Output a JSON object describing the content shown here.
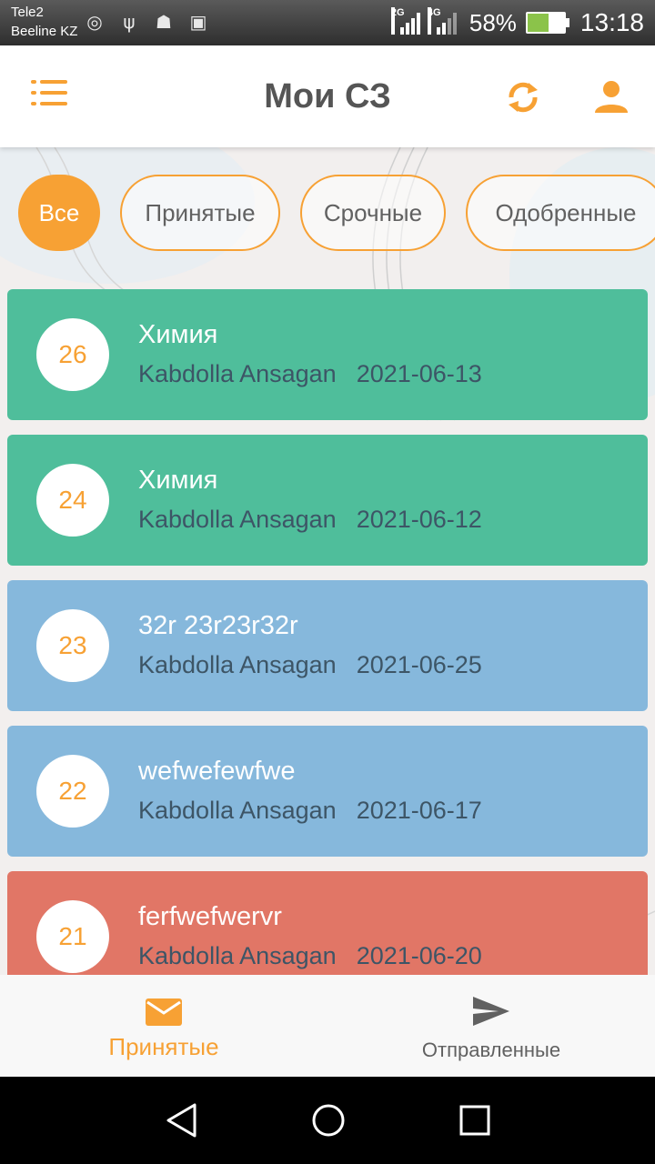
{
  "status_bar": {
    "carrier_1": "Tele2",
    "carrier_2": "Beeline KZ",
    "network_1": "2G",
    "network_2": "4G",
    "battery": "58%",
    "battery_level": 0.58,
    "time": "13:18"
  },
  "app_bar": {
    "title": "Мои СЗ"
  },
  "filters": [
    {
      "label": "Все",
      "active": true
    },
    {
      "label": "Принятые",
      "active": false
    },
    {
      "label": "Срочные",
      "active": false
    },
    {
      "label": "Одобренные",
      "active": false
    }
  ],
  "items": [
    {
      "number": "26",
      "title": "Химия",
      "author": "Kabdolla Ansagan",
      "date": "2021-06-13",
      "color": "#4fbe9b"
    },
    {
      "number": "24",
      "title": "Химия",
      "author": "Kabdolla Ansagan",
      "date": "2021-06-12",
      "color": "#4fbe9b"
    },
    {
      "number": "23",
      "title": "32r 23r23r32r",
      "author": "Kabdolla Ansagan",
      "date": "2021-06-25",
      "color": "#86b8dc"
    },
    {
      "number": "22",
      "title": "wefwefewfwe",
      "author": "Kabdolla Ansagan",
      "date": "2021-06-17",
      "color": "#86b8dc"
    },
    {
      "number": "21",
      "title": "ferfwefwervr",
      "author": "Kabdolla Ansagan",
      "date": "2021-06-20",
      "color": "#e17666"
    }
  ],
  "bottom_nav": {
    "received": "Принятые",
    "sent": "Отправленные"
  },
  "colors": {
    "accent": "#f7a134",
    "nav_inactive": "#616161"
  },
  "icons": [
    "menu-icon",
    "refresh-icon",
    "user-icon",
    "mail-icon",
    "send-icon",
    "back-icon",
    "home-icon",
    "recents-icon"
  ]
}
